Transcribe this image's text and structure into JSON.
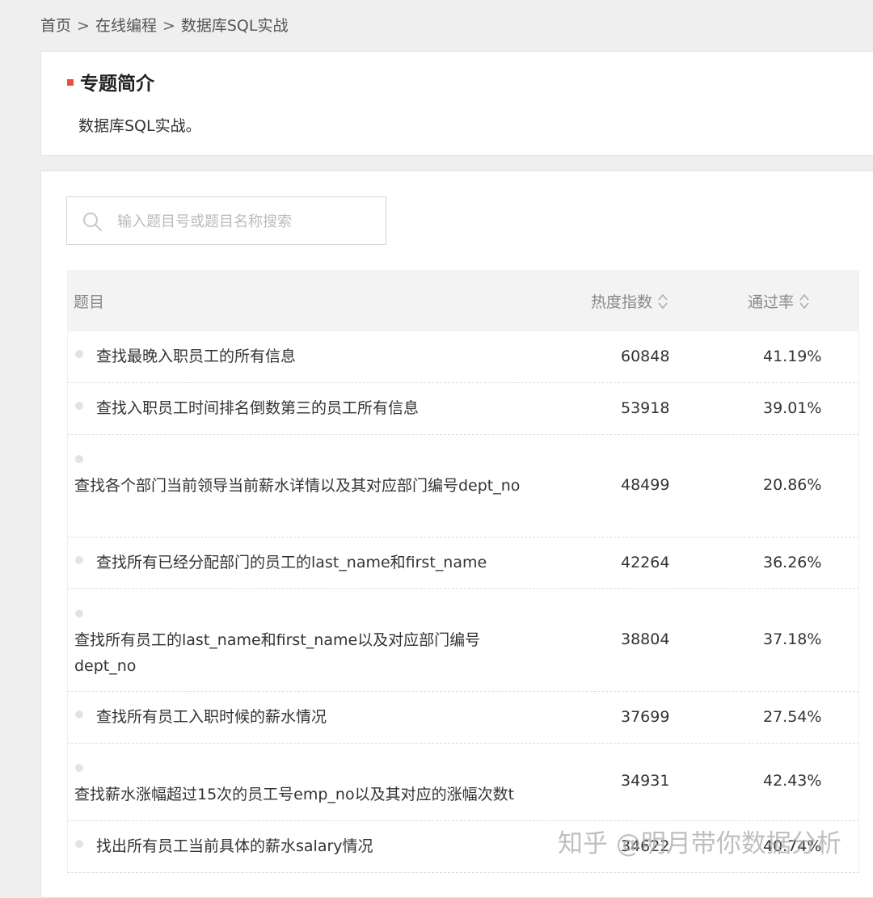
{
  "breadcrumb": {
    "items": [
      "首页",
      "在线编程",
      "数据库SQL实战"
    ],
    "separator": ">"
  },
  "intro": {
    "title": "专题简介",
    "text": "数据库SQL实战。"
  },
  "search": {
    "placeholder": "输入题目号或题目名称搜索",
    "value": ""
  },
  "table": {
    "headers": {
      "title": "题目",
      "heat": "热度指数",
      "pass_rate": "通过率"
    },
    "rows": [
      {
        "title": "查找最晚入职员工的所有信息",
        "heat": "60848",
        "pass_rate": "41.19%"
      },
      {
        "title": "查找入职员工时间排名倒数第三的员工所有信息",
        "heat": "53918",
        "pass_rate": "39.01%"
      },
      {
        "title": "查找各个部门当前领导当前薪水详情以及其对应部门编号dept_no",
        "heat": "48499",
        "pass_rate": "20.86%"
      },
      {
        "title": "查找所有已经分配部门的员工的last_name和first_name",
        "heat": "42264",
        "pass_rate": "36.26%"
      },
      {
        "title": "查找所有员工的last_name和first_name以及对应部门编号dept_no",
        "heat": "38804",
        "pass_rate": "37.18%"
      },
      {
        "title": "查找所有员工入职时候的薪水情况",
        "heat": "37699",
        "pass_rate": "27.54%"
      },
      {
        "title": "查找薪水涨幅超过15次的员工号emp_no以及其对应的涨幅次数t",
        "heat": "34931",
        "pass_rate": "42.43%"
      },
      {
        "title": "找出所有员工当前具体的薪水salary情况",
        "heat": "34622",
        "pass_rate": "40.74%"
      }
    ]
  },
  "watermark": "知乎 @明月带你数据分析",
  "colors": {
    "accent": "#e8503a",
    "background": "#efefef",
    "header_bg": "#f3f3f3"
  }
}
